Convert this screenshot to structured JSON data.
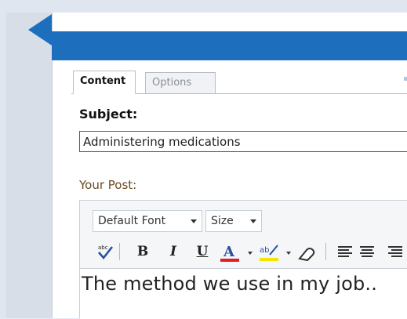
{
  "tabs": [
    {
      "label": "Content",
      "active": true
    },
    {
      "label": "Options",
      "active": false
    }
  ],
  "subject": {
    "label": "Subject:",
    "value": "Administering medications"
  },
  "post": {
    "label": "Your Post:",
    "font_select": "Default Font",
    "size_select": "Size",
    "body_text": "The method we use in my job..",
    "toolbar_icons": [
      "spellcheck-icon",
      "bold-icon",
      "italic-icon",
      "underline-icon",
      "font-color-icon",
      "highlight-icon",
      "eraser-icon",
      "align-left-icon",
      "align-center-icon",
      "align-right-icon"
    ]
  },
  "colors": {
    "header_blue": "#1d6fbe",
    "font_color_bar": "#e02020",
    "highlight_bar": "#f5e400",
    "label_brown": "#6b4b22"
  }
}
